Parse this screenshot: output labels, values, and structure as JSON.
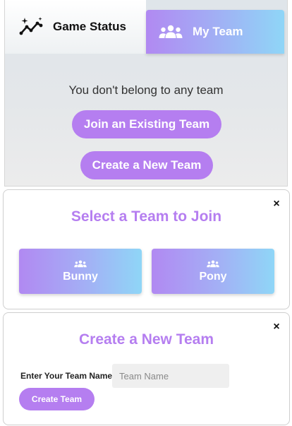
{
  "tabs": {
    "status_label": "Game Status",
    "team_label": "My Team"
  },
  "status": {
    "no_team_message": "You don't belong to any team",
    "join_button": "Join an Existing Team",
    "create_button": "Create a New Team"
  },
  "join_modal": {
    "close": "×",
    "title": "Select a Team to Join",
    "teams": [
      {
        "name": "Bunny"
      },
      {
        "name": "Pony"
      }
    ]
  },
  "create_modal": {
    "close": "×",
    "title": "Create a New Team",
    "field_label": "Enter Your Team Name",
    "field_placeholder": "Team Name",
    "submit_button": "Create Team"
  },
  "colors": {
    "accent": "#b57ef0",
    "gradient_start": "#b189f2",
    "gradient_end": "#8fd6f7"
  }
}
